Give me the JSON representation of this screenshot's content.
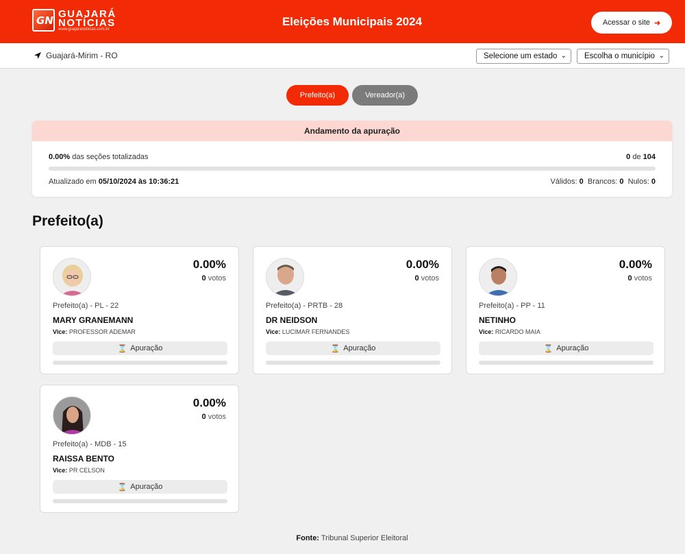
{
  "header": {
    "logo_line1": "GUAJARÁ",
    "logo_line2": "NOTÍCIAS",
    "logo_url": "www.guajaranoticias.com.br",
    "logo_mark": "GN",
    "title": "Eleições Municipais 2024",
    "site_button": "Acessar o site"
  },
  "location": {
    "city": "Guajará-Mirim - RO",
    "state_select": "Selecione um estado",
    "city_select": "Escolha o município"
  },
  "tabs": {
    "prefeito": "Prefeito(a)",
    "vereador": "Vereador(a)"
  },
  "apuracao": {
    "title": "Andamento da apuração",
    "pct": "0.00%",
    "pct_text": "das seções totalizadas",
    "progress": 0,
    "count": "0",
    "count_sep": "de",
    "total": "104",
    "updated_label": "Atualizado em",
    "updated_at": "05/10/2024 às 10:36:21",
    "validos_label": "Válidos:",
    "validos": "0",
    "brancos_label": "Brancos:",
    "brancos": "0",
    "nulos_label": "Nulos:",
    "nulos": "0"
  },
  "section_title": "Prefeito(a)",
  "candidates": [
    {
      "pct": "0.00%",
      "votes": "0",
      "votes_label": "votos",
      "party": "Prefeito(a) - PL - 22",
      "name": "MARY GRANEMANN",
      "vice_label": "Vice:",
      "vice": "PROFESSOR ADEMAR",
      "button": "Apuração",
      "progress": 0
    },
    {
      "pct": "0.00%",
      "votes": "0",
      "votes_label": "votos",
      "party": "Prefeito(a) - PRTB - 28",
      "name": "DR NEIDSON",
      "vice_label": "Vice:",
      "vice": "LUCIMAR FERNANDES",
      "button": "Apuração",
      "progress": 0
    },
    {
      "pct": "0.00%",
      "votes": "0",
      "votes_label": "votos",
      "party": "Prefeito(a) - PP - 11",
      "name": "NETINHO",
      "vice_label": "Vice:",
      "vice": "RICARDO MAIA",
      "button": "Apuração",
      "progress": 0
    },
    {
      "pct": "0.00%",
      "votes": "0",
      "votes_label": "votos",
      "party": "Prefeito(a) - MDB - 15",
      "name": "RAISSA BENTO",
      "vice_label": "Vice:",
      "vice": "PR CELSON",
      "button": "Apuração",
      "progress": 0
    }
  ],
  "footer": {
    "label": "Fonte:",
    "source": "Tribunal Superior Eleitoral"
  },
  "colors": {
    "brand": "#f32a06",
    "panel_head": "#fdd8d2",
    "tab_inactive": "#7b7b7b"
  },
  "icons": {
    "location": "location-arrow-icon",
    "external": "sign-out-icon",
    "hourglass": "hourglass-icon",
    "chevron": "chevron-down-icon"
  }
}
